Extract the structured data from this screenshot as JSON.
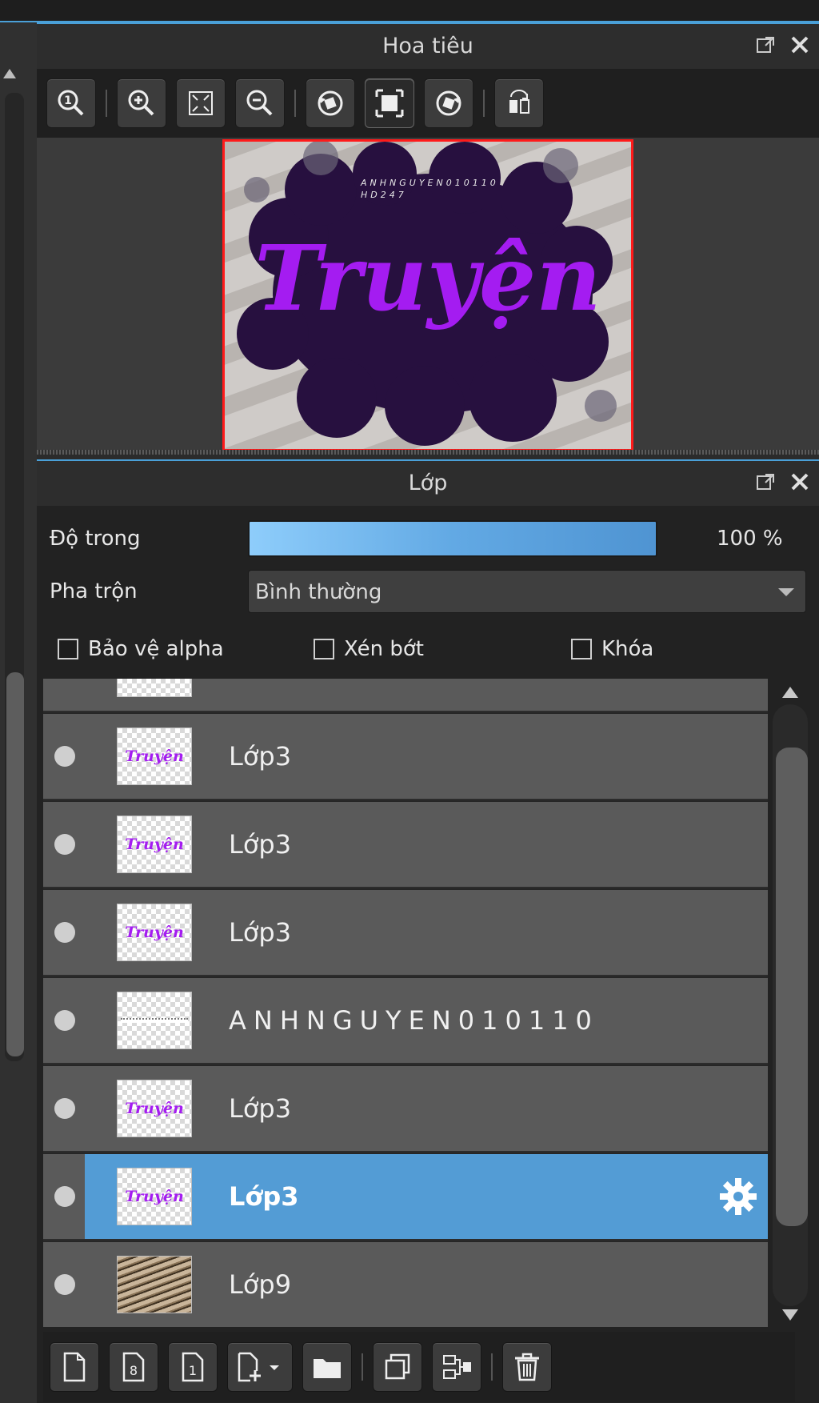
{
  "navigator": {
    "title": "Hoa tiêu",
    "preview_word": "Truyện",
    "preview_small_text_1": "ANHNGUYEN010110",
    "preview_small_text_2": "HD247"
  },
  "layers_panel": {
    "title": "Lớp",
    "opacity_label": "Độ trong",
    "opacity_value": "100 %",
    "opacity_fraction": 1.0,
    "blend_label": "Pha trộn",
    "blend_value": "Bình thường",
    "checkboxes": {
      "protect_alpha": "Bảo vệ alpha",
      "clip": "Xén bớt",
      "lock": "Khóa"
    },
    "layers": [
      {
        "name": "Lớp3",
        "thumb": "text"
      },
      {
        "name": "Lớp3",
        "thumb": "text"
      },
      {
        "name": "Lớp3",
        "thumb": "text"
      },
      {
        "name": "ANHNGUYEN010110",
        "thumb": "line"
      },
      {
        "name": "Lớp3",
        "thumb": "text"
      },
      {
        "name": "Lớp3",
        "thumb": "text",
        "selected": true
      },
      {
        "name": "Lớp9",
        "thumb": "photo"
      }
    ]
  },
  "colors": {
    "selection": "#539cd5",
    "accent_border": "#4aa0d8",
    "preview_frame": "#ff1a1a",
    "text_purple": "#a41cf1"
  },
  "icons": {
    "navigator_toolbar": [
      "zoom-actual-icon",
      "zoom-in-icon",
      "fit-screen-icon",
      "zoom-out-icon",
      "rotate-left-icon",
      "fit-canvas-icon",
      "rotate-right-icon",
      "flip-horizontal-icon"
    ],
    "layer_toolbar": [
      "new-layer-icon",
      "new-8bit-layer-icon",
      "new-1bit-layer-icon",
      "add-layer-dropdown-icon",
      "new-folder-icon",
      "duplicate-layer-icon",
      "merge-down-icon",
      "delete-layer-icon"
    ]
  }
}
